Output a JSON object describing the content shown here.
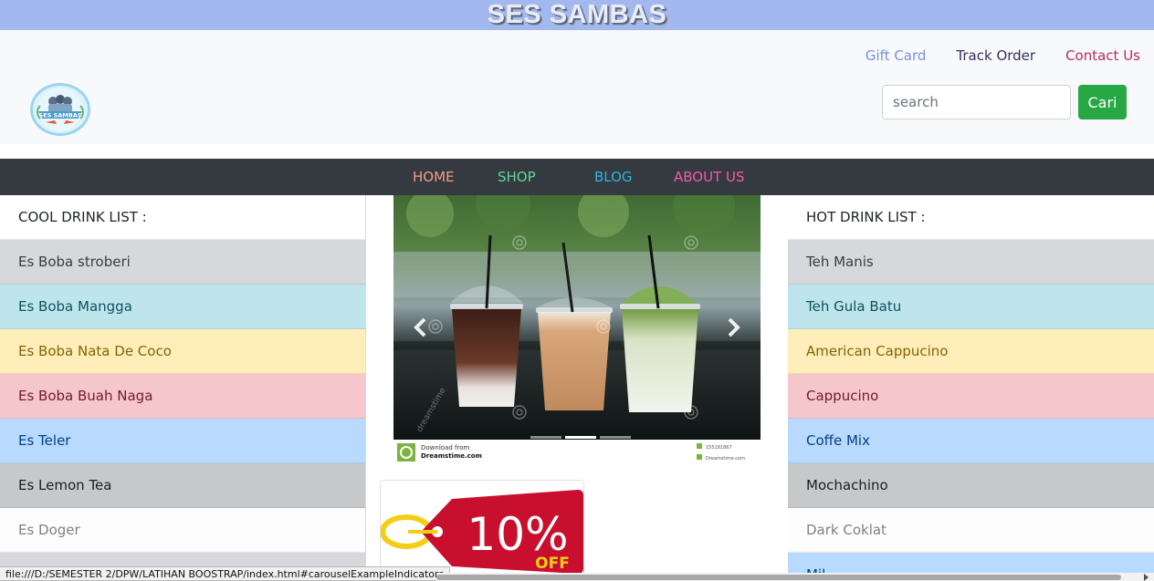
{
  "banner": {
    "title": "SES SAMBAS"
  },
  "header": {
    "links": [
      {
        "label": "Gift Card",
        "color": "#7c8fe0"
      },
      {
        "label": "Track Order",
        "color": "#3b2e63"
      },
      {
        "label": "Contact Us",
        "color": "#b42d5f"
      }
    ],
    "logo_text": "SES SAMBAS",
    "search": {
      "placeholder": "search",
      "value": "",
      "button_label": "Cari",
      "button_color": "#28a745"
    }
  },
  "nav": {
    "items": [
      {
        "label": "HOME",
        "color": "#f49b8a"
      },
      {
        "label": "SHOP",
        "color": "#61d99a"
      },
      {
        "label": "BLOG",
        "color": "#2fb5d8"
      },
      {
        "label": "ABOUT US",
        "color": "#f25aa8"
      }
    ]
  },
  "cool_drinks": {
    "heading": "COOL DRINK LIST :",
    "items": [
      {
        "label": "Es Boba stroberi",
        "bg": "#d6d8db",
        "fg": "#383d41"
      },
      {
        "label": "Es Boba Mangga",
        "bg": "#bee5eb",
        "fg": "#0c5460"
      },
      {
        "label": "Es Boba Nata De Coco",
        "bg": "#ffeeba",
        "fg": "#856404"
      },
      {
        "label": "Es Boba Buah Naga",
        "bg": "#f5c6cb",
        "fg": "#721c24"
      },
      {
        "label": "Es Teler",
        "bg": "#b8daff",
        "fg": "#004085"
      },
      {
        "label": "Es Lemon Tea",
        "bg": "#c6c8ca",
        "fg": "#1b1e21"
      },
      {
        "label": "Es Doger",
        "bg": "#fdfdfe",
        "fg": "#818182"
      },
      {
        "label": "",
        "bg": "#d6d8db",
        "fg": "#383d41"
      }
    ]
  },
  "hot_drinks": {
    "heading": "HOT DRINK LIST :",
    "items": [
      {
        "label": "Teh Manis",
        "bg": "#d6d8db",
        "fg": "#383d41"
      },
      {
        "label": "Teh Gula Batu",
        "bg": "#bee5eb",
        "fg": "#0c5460"
      },
      {
        "label": "American Cappucino",
        "bg": "#ffeeba",
        "fg": "#856404"
      },
      {
        "label": "Cappucino",
        "bg": "#f5c6cb",
        "fg": "#721c24"
      },
      {
        "label": "Coffe Mix",
        "bg": "#b8daff",
        "fg": "#004085"
      },
      {
        "label": "Mochachino",
        "bg": "#c6c8ca",
        "fg": "#1b1e21"
      },
      {
        "label": "Dark Coklat",
        "bg": "#fdfdfe",
        "fg": "#818182"
      },
      {
        "label": "Mil",
        "bg": "#b8daff",
        "fg": "#004085"
      }
    ]
  },
  "carousel": {
    "watermark": "dreamstime",
    "credit_line1": "Download from",
    "credit_line2": "Dreamstime.com",
    "credit_id": "155181867",
    "credit_right": "Dreamstime.com"
  },
  "promo": {
    "percent": "10%",
    "label": "OFF",
    "tag_color": "#c8102e"
  },
  "status_bar": {
    "url": "file:///D:/SEMESTER 2/DPW/LATIHAN BOOSTRAP/index.html#carouselExampleIndicators"
  }
}
